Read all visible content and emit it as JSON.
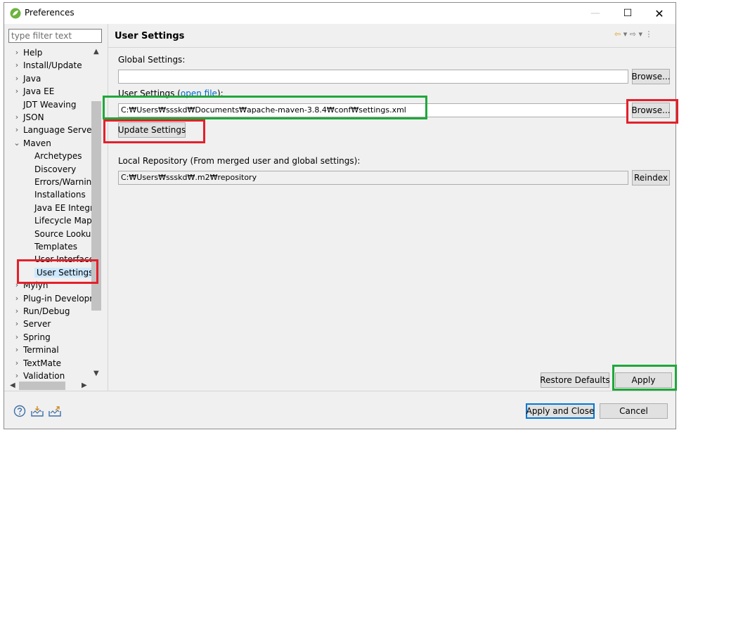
{
  "window": {
    "title": "Preferences",
    "controls": {
      "minimize": "—",
      "maximize": "☐",
      "close": "✕"
    }
  },
  "sidebar": {
    "filter_placeholder": "type filter text",
    "items": [
      {
        "label": "Help",
        "level": 0,
        "chevron": ">"
      },
      {
        "label": "Install/Update",
        "level": 0,
        "chevron": ">"
      },
      {
        "label": "Java",
        "level": 0,
        "chevron": ">"
      },
      {
        "label": "Java EE",
        "level": 0,
        "chevron": ">"
      },
      {
        "label": "JDT Weaving",
        "level": 0,
        "chevron": ""
      },
      {
        "label": "JSON",
        "level": 0,
        "chevron": ">"
      },
      {
        "label": "Language Servers",
        "level": 0,
        "chevron": ">"
      },
      {
        "label": "Maven",
        "level": 0,
        "chevron": "v"
      },
      {
        "label": "Archetypes",
        "level": 1,
        "chevron": ""
      },
      {
        "label": "Discovery",
        "level": 1,
        "chevron": ""
      },
      {
        "label": "Errors/Warnings",
        "level": 1,
        "chevron": ""
      },
      {
        "label": "Installations",
        "level": 1,
        "chevron": ""
      },
      {
        "label": "Java EE Integration",
        "level": 1,
        "chevron": ""
      },
      {
        "label": "Lifecycle Mappings",
        "level": 1,
        "chevron": ""
      },
      {
        "label": "Source Lookup",
        "level": 1,
        "chevron": ""
      },
      {
        "label": "Templates",
        "level": 1,
        "chevron": ""
      },
      {
        "label": "User Interface",
        "level": 1,
        "chevron": ""
      },
      {
        "label": "User Settings",
        "level": 1,
        "chevron": "",
        "selected": true
      },
      {
        "label": "Mylyn",
        "level": 0,
        "chevron": ">"
      },
      {
        "label": "Plug-in Development",
        "level": 0,
        "chevron": ">"
      },
      {
        "label": "Run/Debug",
        "level": 0,
        "chevron": ">"
      },
      {
        "label": "Server",
        "level": 0,
        "chevron": ">"
      },
      {
        "label": "Spring",
        "level": 0,
        "chevron": ">"
      },
      {
        "label": "Terminal",
        "level": 0,
        "chevron": ">"
      },
      {
        "label": "TextMate",
        "level": 0,
        "chevron": ">"
      },
      {
        "label": "Validation",
        "level": 0,
        "chevron": ">"
      }
    ]
  },
  "page": {
    "title": "User Settings",
    "global_settings_label": "Global Settings:",
    "global_settings_value": "",
    "browse_label": "Browse...",
    "user_settings_label": "User Settings (",
    "open_file_link": "open file",
    "user_settings_label_end": "):",
    "user_settings_value": "C:₩Users₩ssskd₩Documents₩apache-maven-3.8.4₩conf₩settings.xml",
    "update_settings_label": "Update Settings",
    "local_repo_label": "Local Repository (From merged user and global settings):",
    "local_repo_value": "C:₩Users₩ssskd₩.m2₩repository",
    "reindex_label": "Reindex",
    "restore_defaults_label": "Restore Defaults",
    "apply_label": "Apply"
  },
  "footer": {
    "apply_close_label": "Apply and Close",
    "cancel_label": "Cancel"
  },
  "colors": {
    "highlight_red": "#e3202a",
    "highlight_green": "#1fa83a",
    "selection": "#cce8ff"
  }
}
